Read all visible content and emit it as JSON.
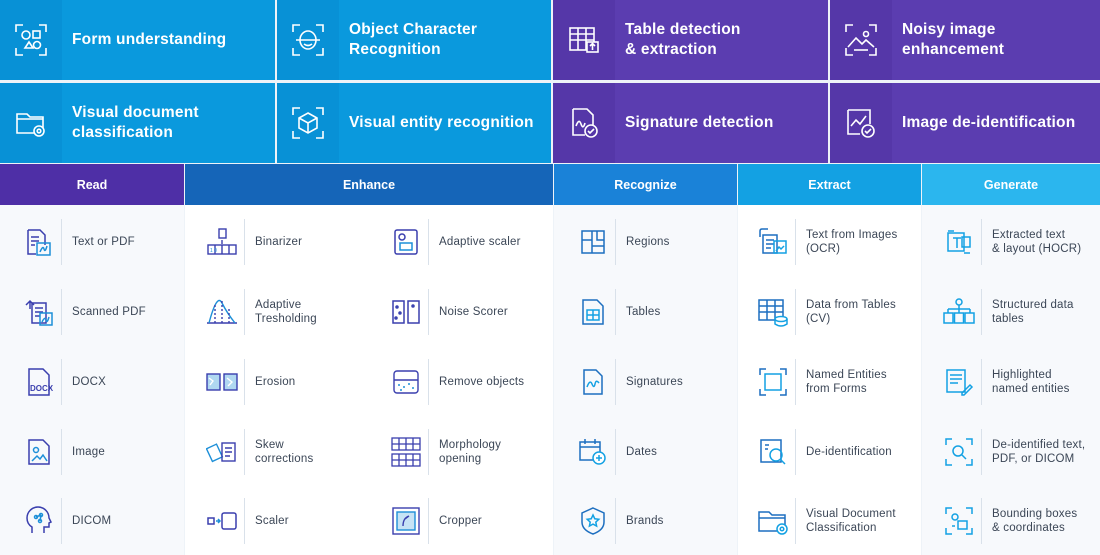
{
  "tiles": [
    {
      "label": "Form understanding",
      "icon": "shapes-scan-icon"
    },
    {
      "label": "Object Character\nRecognition",
      "icon": "face-scan-icon"
    },
    {
      "label": "Table detection\n& extraction",
      "icon": "table-extract-icon"
    },
    {
      "label": "Noisy image\nenhancement",
      "icon": "image-enhance-icon"
    },
    {
      "label": "Visual document\nclassification",
      "icon": "folder-gear-icon"
    },
    {
      "label": "Visual entity recognition",
      "icon": "cube-scan-icon"
    },
    {
      "label": "Signature detection",
      "icon": "signature-check-icon"
    },
    {
      "label": "Image de-identification",
      "icon": "chart-check-icon"
    }
  ],
  "categories": [
    {
      "label": "Read",
      "color": "#4e2fa6"
    },
    {
      "label": "Enhance",
      "color": "#1565b8"
    },
    {
      "label": "Recognize",
      "color": "#1a82d8"
    },
    {
      "label": "Extract",
      "color": "#13a1e3"
    },
    {
      "label": "Generate",
      "color": "#2bb6ee"
    }
  ],
  "rows": [
    [
      {
        "label": "Text or PDF",
        "icon": "text-pdf-icon"
      },
      {
        "label": "Binarizer",
        "icon": "binarizer-icon"
      },
      {
        "label": "Adaptive scaler",
        "icon": "adaptive-scaler-icon"
      },
      {
        "label": "Regions",
        "icon": "regions-icon"
      },
      {
        "label": "Text from Images\n(OCR)",
        "icon": "ocr-icon"
      },
      {
        "label": "Extracted text\n& layout (HOCR)",
        "icon": "hocr-icon"
      }
    ],
    [
      {
        "label": "Scanned PDF",
        "icon": "scanned-pdf-icon"
      },
      {
        "label": "Adaptive\nTresholding",
        "icon": "thresholding-icon"
      },
      {
        "label": "Noise Scorer",
        "icon": "noise-scorer-icon"
      },
      {
        "label": "Tables",
        "icon": "tables-icon"
      },
      {
        "label": "Data from Tables\n(CV)",
        "icon": "table-data-icon"
      },
      {
        "label": "Structured data\ntables",
        "icon": "structured-data-icon"
      }
    ],
    [
      {
        "label": "DOCX",
        "icon": "docx-icon"
      },
      {
        "label": "Erosion",
        "icon": "erosion-icon"
      },
      {
        "label": "Remove objects",
        "icon": "remove-objects-icon"
      },
      {
        "label": "Signatures",
        "icon": "signatures-icon"
      },
      {
        "label": "Named Entities\nfrom Forms",
        "icon": "named-entities-icon"
      },
      {
        "label": "Highlighted\nnamed entities",
        "icon": "highlighted-entities-icon"
      }
    ],
    [
      {
        "label": "Image",
        "icon": "image-icon"
      },
      {
        "label": "Skew\ncorrections",
        "icon": "skew-icon"
      },
      {
        "label": "Morphology\nopening",
        "icon": "morphology-icon"
      },
      {
        "label": "Dates",
        "icon": "dates-icon"
      },
      {
        "label": "De-identification",
        "icon": "deidentification-icon"
      },
      {
        "label": "De-identified text,\nPDF, or DICOM",
        "icon": "deidentified-output-icon"
      }
    ],
    [
      {
        "label": "DICOM",
        "icon": "dicom-icon"
      },
      {
        "label": "Scaler",
        "icon": "scaler-icon"
      },
      {
        "label": "Cropper",
        "icon": "cropper-icon"
      },
      {
        "label": "Brands",
        "icon": "brands-icon"
      },
      {
        "label": "Visual Document\nClassification",
        "icon": "visual-doc-class-icon"
      },
      {
        "label": "Bounding boxes\n& coordinates",
        "icon": "bounding-boxes-icon"
      }
    ]
  ]
}
